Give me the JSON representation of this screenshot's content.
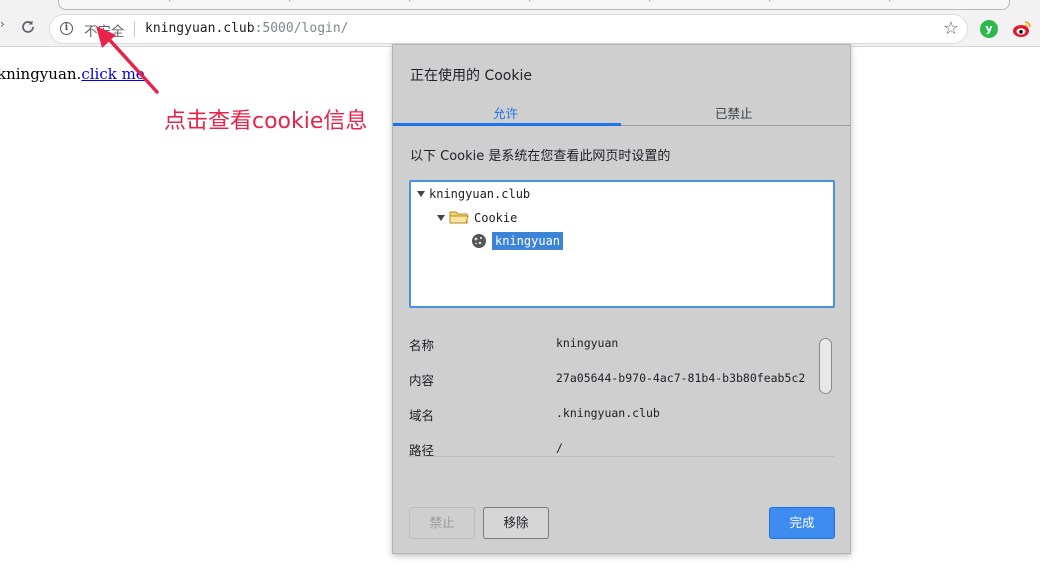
{
  "browser": {
    "security_label": "不安全",
    "url_host": "kningyuan.club",
    "url_rest": ":5000/login/"
  },
  "page": {
    "text_prefix": "kningyuan.",
    "link_text": "click me"
  },
  "annotation": {
    "text": "点击查看cookie信息",
    "color": "#e8234a"
  },
  "dialog": {
    "title": "正在使用的 Cookie",
    "tabs": [
      {
        "label": "允许",
        "active": true
      },
      {
        "label": "已禁止",
        "active": false
      }
    ],
    "description": "以下 Cookie 是系统在您查看此网页时设置的",
    "tree": {
      "domain": "kningyuan.club",
      "folder": "Cookie",
      "cookie": "kningyuan"
    },
    "details": [
      {
        "label": "名称",
        "value": "kningyuan"
      },
      {
        "label": "内容",
        "value": "27a05644-b970-4ac7-81b4-b3b80feab5c2"
      },
      {
        "label": "域名",
        "value": ".kningyuan.club"
      },
      {
        "label": "路径",
        "value": "/"
      }
    ],
    "buttons": {
      "block": "禁止",
      "remove": "移除",
      "done": "完成"
    }
  },
  "colors": {
    "accent": "#1a73e8",
    "selection": "#3b84d8"
  }
}
